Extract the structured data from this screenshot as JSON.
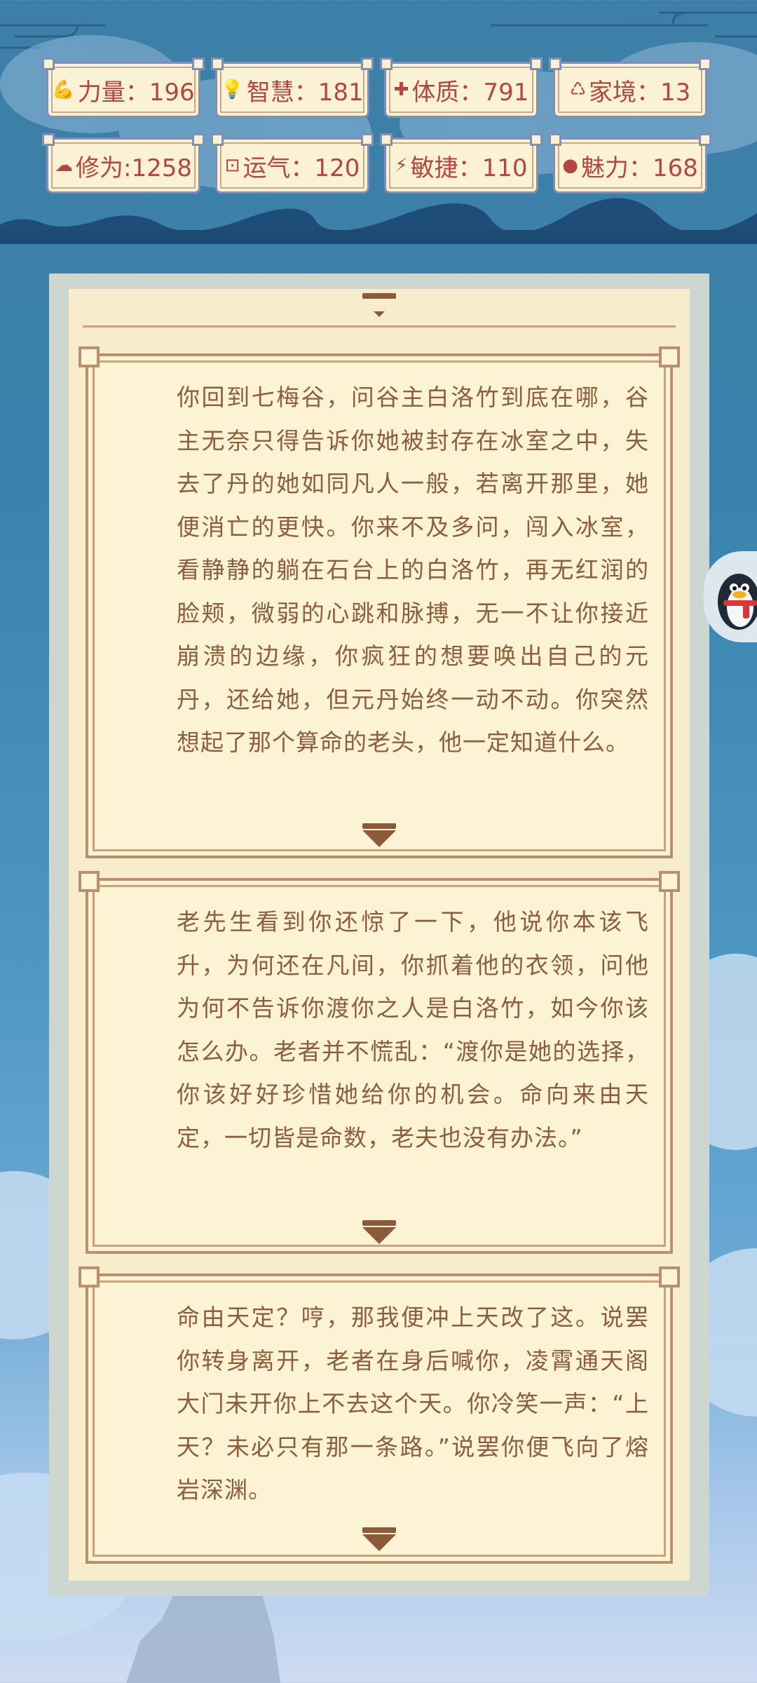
{
  "stats": [
    {
      "icon": "strength-icon",
      "glyph": "💪",
      "label": "力量",
      "value": "196",
      "text": "力量：196"
    },
    {
      "icon": "wisdom-icon",
      "glyph": "💡",
      "label": "智慧",
      "value": "181",
      "text": "智慧：181"
    },
    {
      "icon": "constitution-icon",
      "glyph": "✚",
      "label": "体质",
      "value": "791",
      "text": "体质：791"
    },
    {
      "icon": "family-icon",
      "glyph": "♺",
      "label": "家境",
      "value": "13",
      "text": "家境：13"
    },
    {
      "icon": "cultivation-icon",
      "glyph": "☁",
      "label": "修为",
      "value": "1258",
      "text": "修为:1258"
    },
    {
      "icon": "luck-icon",
      "glyph": "⊡",
      "label": "运气",
      "value": "120",
      "text": "运气：120"
    },
    {
      "icon": "agility-icon",
      "glyph": "⚡",
      "label": "敏捷",
      "value": "110",
      "text": "敏捷：110"
    },
    {
      "icon": "charm-icon",
      "glyph": "●",
      "label": "魅力",
      "value": "168",
      "text": "魅力：168"
    }
  ],
  "story": [
    {
      "text": "你回到七梅谷，问谷主白洛竹到底在哪，谷主无奈只得告诉你她被封存在冰室之中，失去了丹的她如同凡人一般，若离开那里，她便消亡的更快。你来不及多问，闯入冰室，看静静的躺在石台上的白洛竹，再无红润的脸颊，微弱的心跳和脉搏，无一不让你接近崩溃的边缘，你疯狂的想要唤出自己的元丹，还给她，但元丹始终一动不动。你突然想起了那个算命的老头，他一定知道什么。"
    },
    {
      "text": "老先生看到你还惊了一下，他说你本该飞升，为何还在凡间，你抓着他的衣领，问他为何不告诉你渡你之人是白洛竹，如今你该怎么办。老者并不慌乱：“渡你是她的选择，你该好好珍惜她给你的机会。命向来由天定，一切皆是命数，老夫也没有办法。”"
    },
    {
      "text": "命由天定？哼，那我便冲上天改了这。说罢你转身离开，老者在身后喊你，凌霄通天阁大门未开你上不去这个天。你冷笑一声：“上天？未必只有那一条路。”说罢你便飞向了熔岩深渊。"
    }
  ],
  "colors": {
    "stat_text": "#b2473f",
    "story_text": "#8c5e3c",
    "card_bg": "#fcf3d4",
    "frame": "#b89069"
  }
}
